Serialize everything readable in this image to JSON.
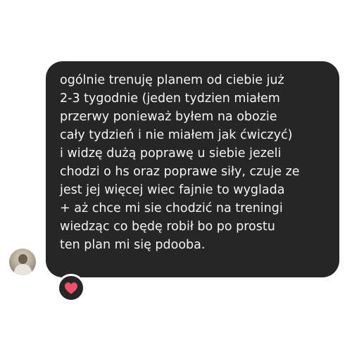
{
  "message": {
    "text": "ogólnie trenuję planem od ciebie już\n2-3 tygodnie (jeden tydzien miałem\nprzerwy ponieważ byłem na obozie\ncały tydzień i nie miałem jak ćwiczyć)\ni widzę dużą poprawę u siebie jezeli\nchodzi o hs oraz poprawe siły, czuje ze\njest jej więcej wiec fajnie to wyglada\n+ aż chce mi sie chodzić na treningi\nwiedząc co będę robił bo po prostu\nten plan mi się pdooba.",
    "bubble_color": "#262626",
    "text_color": "#f4f4f4"
  },
  "sender": {
    "avatar_icon": "user-photo-avatar"
  },
  "reaction": {
    "icon": "heart-icon",
    "color": "#f0506a"
  }
}
